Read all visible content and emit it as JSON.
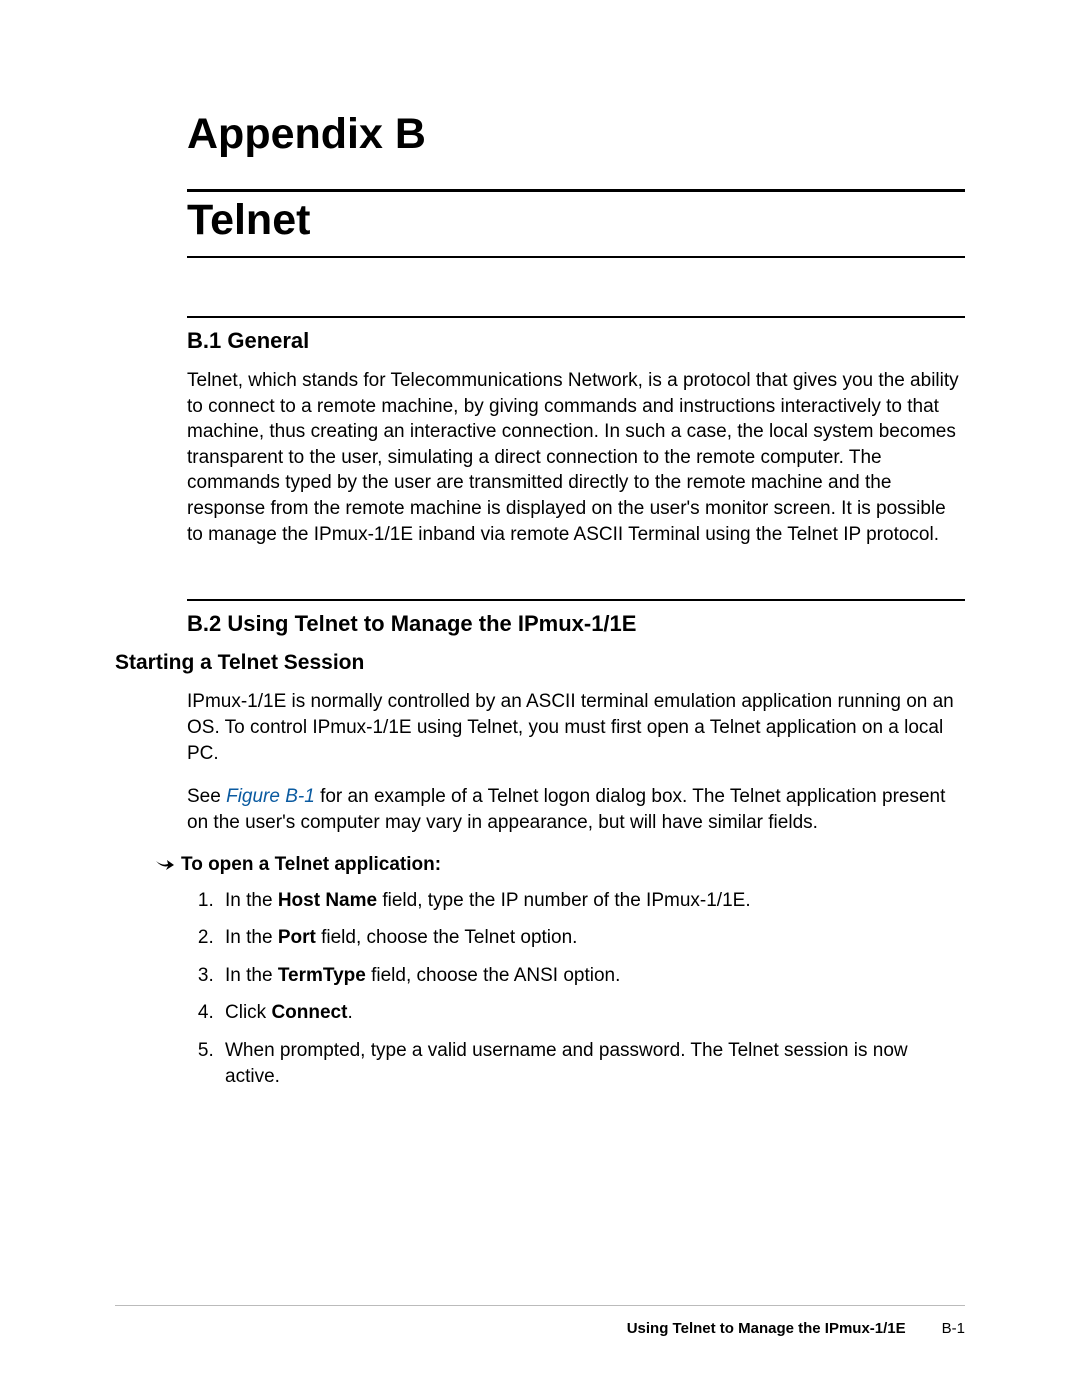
{
  "title": {
    "appendix": "Appendix B",
    "subject": "Telnet"
  },
  "sections": {
    "b1": {
      "heading": "B.1  General",
      "paragraph": "Telnet, which stands for Telecommunications Network, is a protocol that gives you the ability to connect to a remote machine, by giving commands and instructions interactively to that machine, thus creating an interactive connection. In such a case, the local system becomes transparent to the user, simulating a direct connection to the remote computer. The commands typed by the user are transmitted directly to the remote machine and the response from the remote machine is displayed on the user's monitor screen. It is possible to manage the IPmux-1/1E inband via remote ASCII Terminal using the Telnet IP protocol."
    },
    "b2": {
      "heading": "B.2  Using Telnet to Manage the IPmux-1/1E",
      "sub_heading": "Starting a Telnet Session",
      "p1": "IPmux-1/1E is normally controlled by an ASCII terminal emulation application running on an OS. To control IPmux-1/1E using Telnet, you must first open a Telnet application on a local PC.",
      "p2_prefix": "See ",
      "p2_link": "Figure B-1",
      "p2_suffix": " for an example of a Telnet logon dialog box. The Telnet application present on the user's computer may vary in appearance, but will have similar fields.",
      "proc_title": "To open a Telnet application:",
      "steps": {
        "s1a": "In the ",
        "s1b": "Host Name",
        "s1c": " field, type the IP number of the IPmux-1/1E.",
        "s2a": "In the ",
        "s2b": "Port",
        "s2c": " field, choose the Telnet option.",
        "s3a": "In the ",
        "s3b": "TermType",
        "s3c": " field, choose the ANSI option.",
        "s4a": "Click ",
        "s4b": "Connect",
        "s4c": ".",
        "s5": "When prompted, type a valid username and password. The Telnet session is now active."
      }
    }
  },
  "footer": {
    "section_title": "Using Telnet to Manage the IPmux-1/1E",
    "page_number": "B-1"
  }
}
